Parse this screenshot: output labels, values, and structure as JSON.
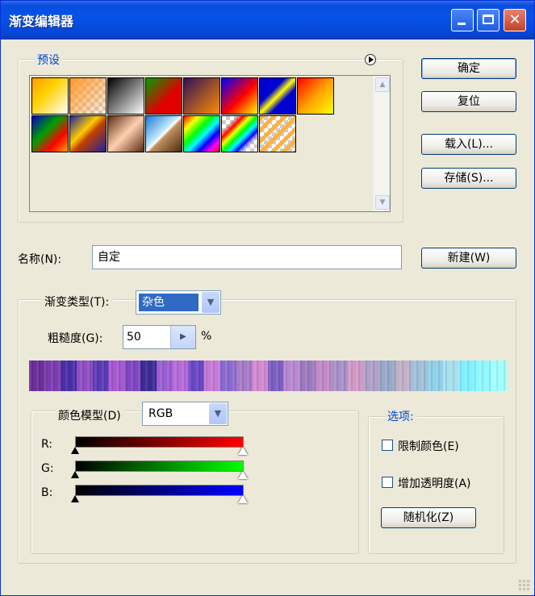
{
  "window": {
    "title": "渐变编辑器"
  },
  "presets": {
    "legend": "预设",
    "menu_icon": "circle-arrow-icon"
  },
  "buttons": {
    "ok": "确定",
    "reset": "复位",
    "load": "载入(L)...",
    "save": "存储(S)...",
    "new": "新建(W)",
    "randomize": "随机化(Z)"
  },
  "name": {
    "label": "名称(N):",
    "value": "自定"
  },
  "gradient_type": {
    "label": "渐变类型(T):",
    "value": "杂色"
  },
  "roughness": {
    "label": "粗糙度(G):",
    "value": "50",
    "unit": "%"
  },
  "color_model": {
    "label": "颜色模型(D)",
    "value": "RGB"
  },
  "channels": [
    {
      "label": "R:",
      "color": "#ff0000"
    },
    {
      "label": "G:",
      "color": "#00ff00"
    },
    {
      "label": "B:",
      "color": "#0000ff"
    }
  ],
  "options": {
    "legend": "选项:",
    "restrict_colors": {
      "label": "限制颜色(E)",
      "checked": false
    },
    "add_transparency": {
      "label": "增加透明度(A)",
      "checked": false
    }
  },
  "noise_colors": [
    "#6b2e9a",
    "#7a3cb0",
    "#4a2ea8",
    "#8e4ec4",
    "#5b3ab6",
    "#a558d0",
    "#7f46c2",
    "#3e2a96",
    "#9a5fd4",
    "#b46ad8",
    "#6a48c6",
    "#c679d8",
    "#8b6ad0",
    "#a67bc8",
    "#d28ad0",
    "#7d5ec4",
    "#b888d0",
    "#9c7ac0",
    "#c08ac8",
    "#a890c8",
    "#d09ac8",
    "#b0a0c8",
    "#98a8c8",
    "#c0b0c8",
    "#a0c0d8",
    "#90d0e8",
    "#a8e0f0",
    "#80f0ff",
    "#90f8ff",
    "#a0ffff"
  ]
}
